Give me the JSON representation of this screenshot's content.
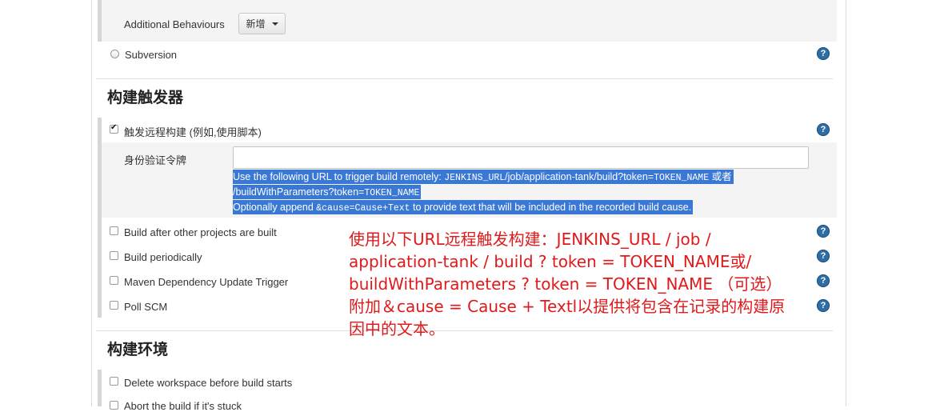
{
  "scm": {
    "additional_behaviours_label": "Additional Behaviours",
    "add_button_label": "新增",
    "subversion_label": "Subversion"
  },
  "build_triggers": {
    "title": "构建触发器",
    "remote_trigger": {
      "label": "触发远程构建 (例如,使用脚本)",
      "checked": true,
      "token_label": "身份验证令牌",
      "token_value": "",
      "help_line1_a": "Use the following URL to trigger build remotely: ",
      "help_line1_code1": "JENKINS_URL",
      "help_line1_b": "/job/application-tank/build?token=",
      "help_line1_code2": "TOKEN_NAME",
      "help_line1_c": " 或者",
      "help_line2_a": "/buildWithParameters?token=",
      "help_line2_code": "TOKEN_NAME",
      "help_line3_a": "Optionally append ",
      "help_line3_code": "&cause=Cause+Text",
      "help_line3_b": " to provide text that will be included in the recorded build cause."
    },
    "options": [
      {
        "label": "Build after other projects are built",
        "checked": false
      },
      {
        "label": "Build periodically",
        "checked": false
      },
      {
        "label": "Maven Dependency Update Trigger",
        "checked": false
      },
      {
        "label": "Poll SCM",
        "checked": false
      }
    ]
  },
  "build_env": {
    "title": "构建环境",
    "options": [
      {
        "label": "Delete workspace before build starts",
        "checked": false
      },
      {
        "label": "Abort the build if it's stuck",
        "checked": false
      }
    ]
  },
  "annotation": {
    "text": "使用以下URL远程触发构建：JENKINS_URL / job / application-tank / build ? token = TOKEN_NAME或/ buildWithParameters ? token = TOKEN_NAME （可选）附加＆cause = Cause + Textl以提供将包含在记录的构建原因中的文本。"
  },
  "help_icon_glyph": "?",
  "colors": {
    "help_icon": "#2f6ea5",
    "selection_highlight": "#3a78d6",
    "annotation": "#e0191b"
  }
}
